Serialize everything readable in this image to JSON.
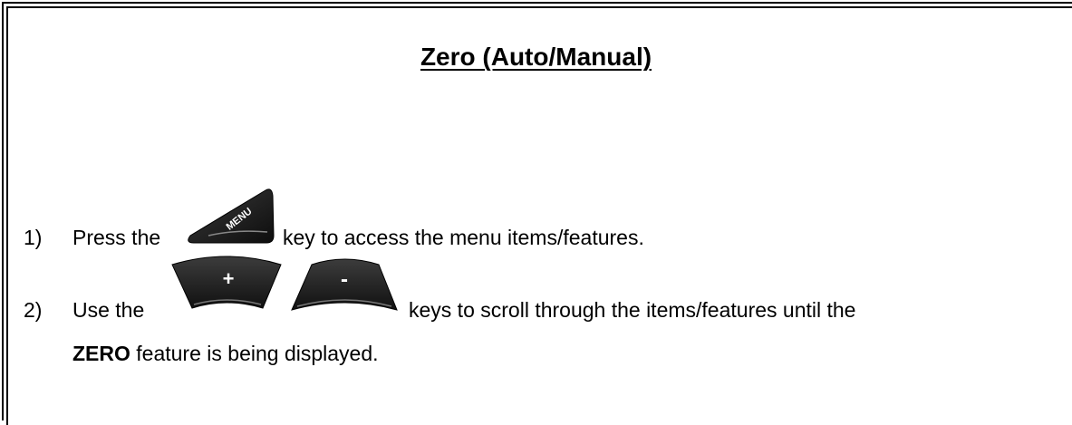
{
  "title": "Zero (Auto/Manual)",
  "steps": [
    {
      "number": "1)",
      "before": "Press the",
      "key": "MENU",
      "after": "key to access the menu items/features."
    },
    {
      "number": "2)",
      "before": "Use the",
      "keys": [
        "+",
        "-"
      ],
      "after": "keys to scroll through the items/features until the",
      "continuation_bold": "ZERO",
      "continuation_rest": "feature is being displayed."
    }
  ],
  "icons": {
    "menu_key": "menu-key-icon",
    "plus_key": "plus-key-icon",
    "minus_key": "minus-key-icon"
  },
  "colors": {
    "text": "#000000",
    "key_fill": "#1a1a1a",
    "key_label": "#ffffff"
  }
}
